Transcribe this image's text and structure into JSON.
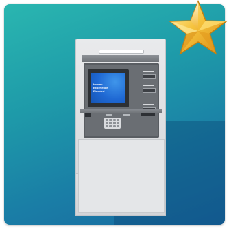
{
  "atm": {
    "screen_lines": [
      "Human",
      "Experience",
      "Elevated"
    ]
  },
  "colors": {
    "background_top": "#2ab6b0",
    "background_bottom": "#1868a0",
    "screen_blue": "#1f68d3",
    "star_gold": "#f2b52a"
  },
  "icons": [
    "star-icon",
    "atm-icon"
  ]
}
